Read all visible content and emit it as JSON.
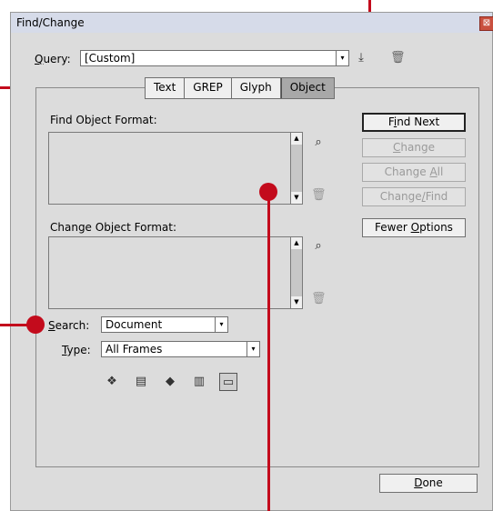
{
  "dialog": {
    "title": "Find/Change",
    "close_glyph": "⊠"
  },
  "query": {
    "label_key": "Q",
    "label_rest": "uery:",
    "value": "[Custom]",
    "dropdown_glyph": "▾",
    "save_icon": "save-query-icon",
    "delete_icon": "trash-icon"
  },
  "tabs": [
    {
      "label": "Text",
      "active": false
    },
    {
      "label": "GREP",
      "active": false
    },
    {
      "label": "Glyph",
      "active": false
    },
    {
      "label": "Object",
      "active": true
    }
  ],
  "find_format": {
    "label": "Find Object Format:",
    "specify_icon": "specify-attributes-icon",
    "clear_icon": "trash-icon"
  },
  "change_format": {
    "label": "Change Object Format:",
    "specify_icon": "specify-attributes-icon",
    "clear_icon": "trash-icon"
  },
  "search": {
    "label_key": "S",
    "label_rest": "earch:",
    "value": "Document"
  },
  "type": {
    "label_key": "T",
    "label_rest": "ype:",
    "value": "All Frames"
  },
  "options_icons": [
    {
      "name": "include-locked-layers-icon",
      "glyph": "❖",
      "selected": false
    },
    {
      "name": "include-locked-stories-icon",
      "glyph": "▤",
      "selected": false
    },
    {
      "name": "include-hidden-layers-icon",
      "glyph": "◆",
      "selected": false
    },
    {
      "name": "include-master-pages-icon",
      "glyph": "▥",
      "selected": false
    },
    {
      "name": "include-footnotes-icon",
      "glyph": "▭",
      "selected": true
    }
  ],
  "buttons": {
    "find_next": {
      "key": "i",
      "pre": "F",
      "post": "nd Next"
    },
    "change": {
      "key": "C",
      "pre": "",
      "post": "hange"
    },
    "change_all": {
      "key": "A",
      "pre": "Change ",
      "post": "ll"
    },
    "change_find": {
      "key": "/",
      "pre": "Change",
      "post": "Find"
    },
    "fewer_options": {
      "key": "O",
      "pre": "Fewer ",
      "post": "ptions"
    },
    "done": {
      "key": "D",
      "pre": "",
      "post": "one"
    }
  },
  "colors": {
    "callout": "#c30b1c",
    "dialog_bg": "#dcdcdc",
    "titlebar": "#d6dbe9"
  }
}
